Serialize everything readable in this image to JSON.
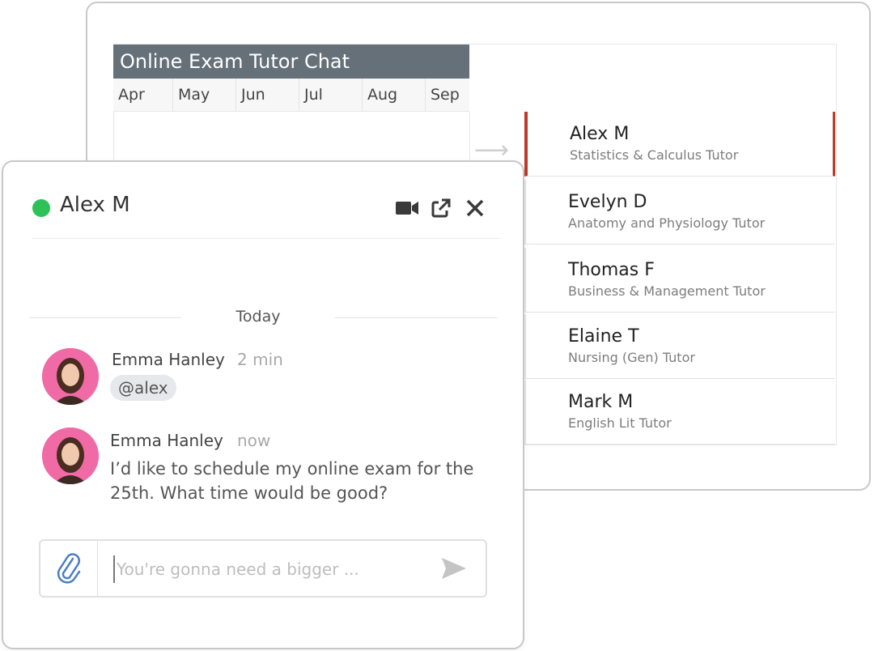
{
  "planner": {
    "title": "Online Exam Tutor Chat",
    "months": [
      "Apr",
      "May",
      "Jun",
      "Jul",
      "Aug",
      "Sep"
    ],
    "tutors": [
      {
        "name": "Alex M",
        "subject": "Statistics & Calculus Tutor",
        "active": true
      },
      {
        "name": "Evelyn D",
        "subject": "Anatomy and Physiology Tutor",
        "active": false
      },
      {
        "name": "Thomas F",
        "subject": "Business & Management Tutor",
        "active": false
      },
      {
        "name": "Elaine T",
        "subject": "Nursing (Gen) Tutor",
        "active": false
      },
      {
        "name": "Mark M",
        "subject": "English Lit Tutor",
        "active": false
      }
    ]
  },
  "chat": {
    "contact_name": "Alex M",
    "status_color": "#2ec158",
    "icons": [
      "video-camera-icon",
      "pop-out-icon",
      "close-icon"
    ],
    "day_separator": "Today",
    "messages": [
      {
        "author": "Emma Hanley",
        "time": "2 min",
        "mention": "@alex"
      },
      {
        "author": "Emma Hanley",
        "time": "now",
        "text": "I’d  like to schedule my online exam for the 25th. What time would be good?"
      }
    ],
    "composer": {
      "placeholder": "You're gonna need a bigger ...",
      "value": ""
    }
  },
  "colors": {
    "title_bar": "#657079",
    "active_accent": "#c0392b",
    "online": "#2ec158",
    "avatar_bg": "#f06aa5",
    "attach_icon": "#4a7fc6"
  }
}
